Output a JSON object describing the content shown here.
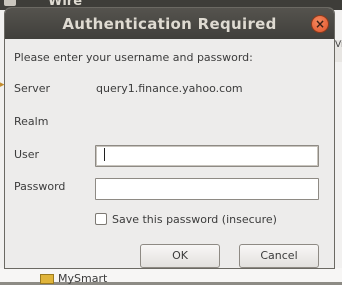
{
  "background": {
    "window_title": "Wire",
    "right_tab_label": "Vi",
    "tree_item_label": "MySmart"
  },
  "dialog": {
    "title": "Authentication Required",
    "close_icon": "close-icon",
    "prompt": "Please enter your username and password:",
    "fields": {
      "server_label": "Server",
      "server_value": "query1.finance.yahoo.com",
      "realm_label": "Realm",
      "realm_value": "",
      "user_label": "User",
      "user_value": "",
      "password_label": "Password",
      "password_value": ""
    },
    "save_password": {
      "label": "Save this password (insecure)",
      "checked": false
    },
    "buttons": {
      "ok": "OK",
      "cancel": "Cancel"
    }
  },
  "colors": {
    "titlebar": "#403f3b",
    "close_button": "#e0542a",
    "dialog_bg": "#edeceb"
  }
}
